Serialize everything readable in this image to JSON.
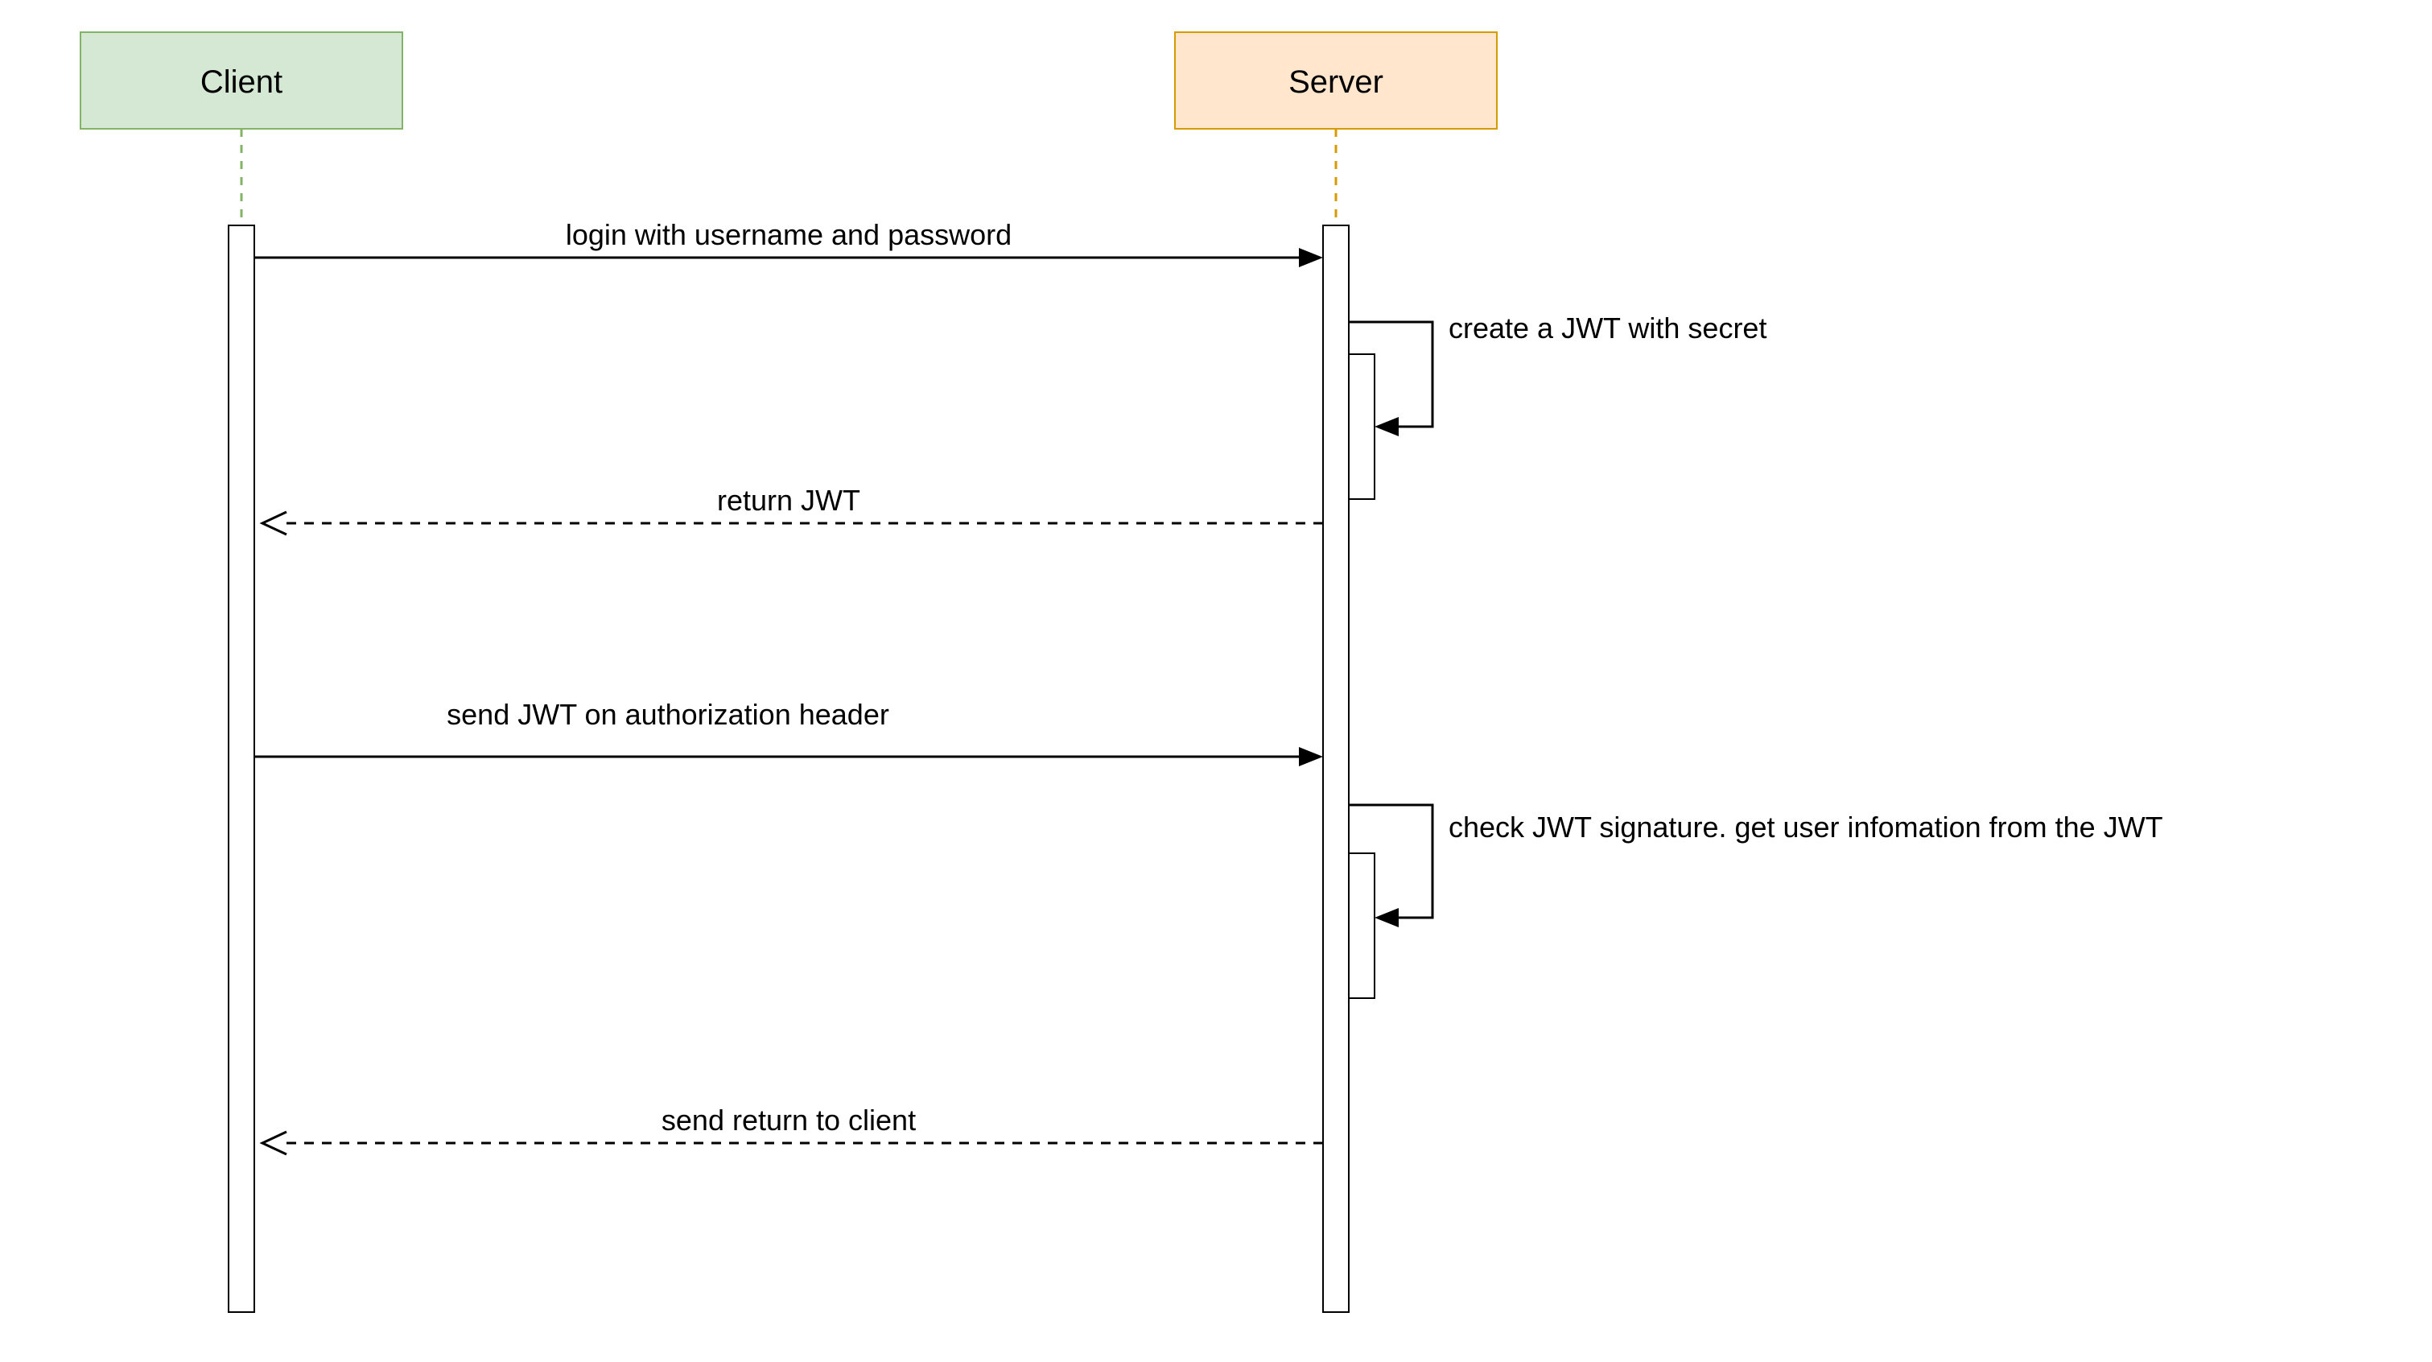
{
  "diagram": {
    "type": "sequence",
    "actors": {
      "client": {
        "label": "Client",
        "fill": "#d5e8d4",
        "stroke": "#82b366"
      },
      "server": {
        "label": "Server",
        "fill": "#ffe6cc",
        "stroke": "#d79b00"
      }
    },
    "messages": {
      "m1": {
        "label": "login with username and password"
      },
      "m2": {
        "label": "create a JWT with secret"
      },
      "m3": {
        "label": "return JWT"
      },
      "m4": {
        "label": "send JWT on authorization header"
      },
      "m5": {
        "label": "check JWT signature. get user infomation from the JWT"
      },
      "m6": {
        "label": "send return to client"
      }
    }
  }
}
